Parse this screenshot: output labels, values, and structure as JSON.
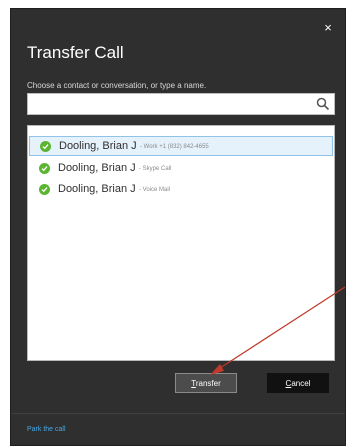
{
  "dialog": {
    "title": "Transfer Call",
    "prompt": "Choose a contact or conversation, or type a name.",
    "close_glyph": "×"
  },
  "search": {
    "value": "",
    "placeholder": "",
    "icon": "search-icon"
  },
  "contacts": [
    {
      "name": "Dooling, Brian J",
      "detail": "- Work +1 (832) 842-4655",
      "status": "available",
      "status_color": "#5cb531"
    },
    {
      "name": "Dooling, Brian J",
      "detail": "- Skype Call",
      "status": "available",
      "status_color": "#5cb531"
    },
    {
      "name": "Dooling, Brian J",
      "detail": "- Voice Mail",
      "status": "available",
      "status_color": "#5cb531"
    }
  ],
  "buttons": {
    "transfer_first": "T",
    "transfer_rest": "ransfer",
    "cancel_first": "C",
    "cancel_rest": "ancel"
  },
  "footer": {
    "park_link": "Park the call"
  },
  "colors": {
    "dialog_bg": "#2f2f2f",
    "selection_bg": "#e5f1fb",
    "link": "#46a8e6",
    "annotation_arrow": "#c0392b"
  }
}
